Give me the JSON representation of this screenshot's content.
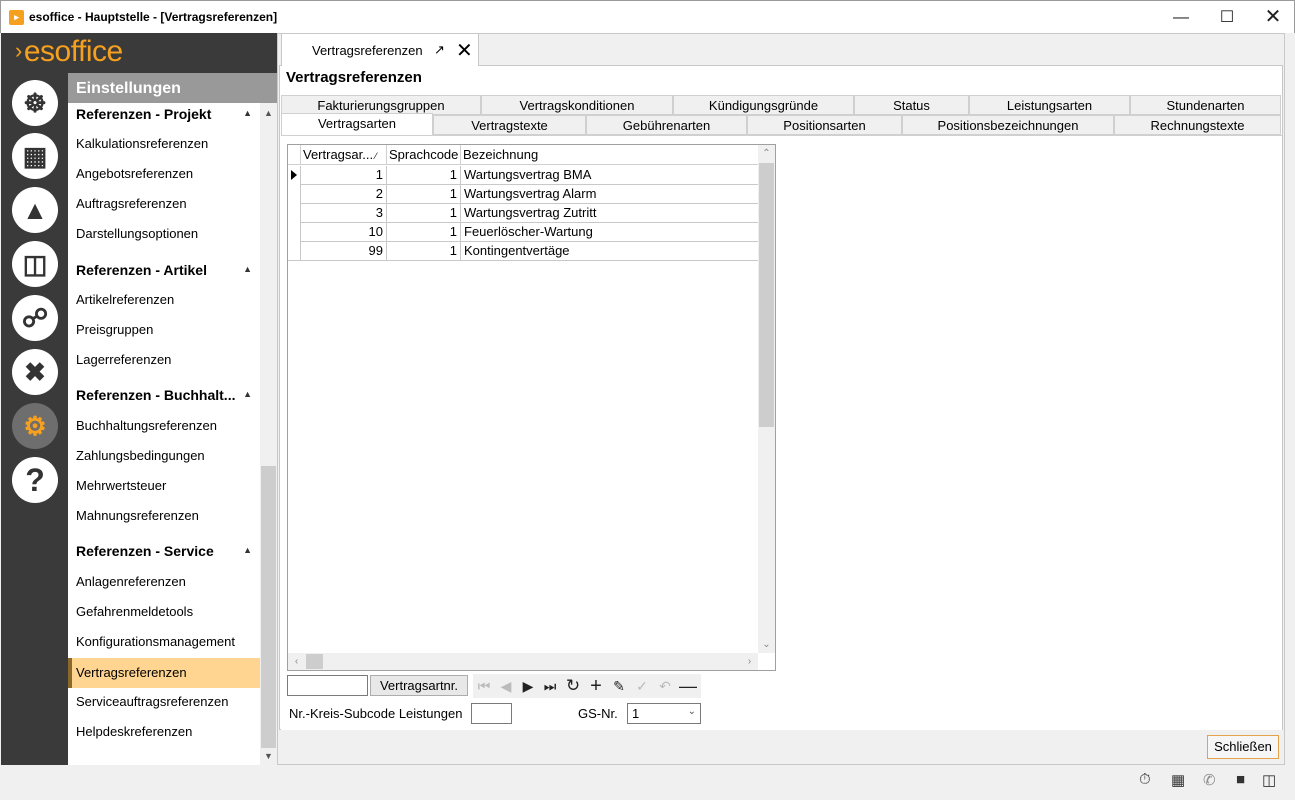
{
  "window": {
    "title": "esoffice - Hauptstelle - [Vertragsreferenzen]",
    "app_icon": "esoffice-app-icon"
  },
  "logo": "esoffice",
  "sidebar_icons": [
    "helm-icon",
    "calculator-icon",
    "siren-icon",
    "money-icon",
    "headset-icon",
    "tools-icon",
    "gears-icon",
    "help-icon"
  ],
  "nav": {
    "header": "Einstellungen",
    "sections": [
      {
        "title": "Referenzen - Projekt",
        "items": [
          "Kalkulationsreferenzen",
          "Angebotsreferenzen",
          "Auftragsreferenzen",
          "Darstellungsoptionen"
        ]
      },
      {
        "title": "Referenzen - Artikel",
        "items": [
          "Artikelreferenzen",
          "Preisgruppen",
          "Lagerreferenzen"
        ]
      },
      {
        "title": "Referenzen - Buchhalt...",
        "items": [
          "Buchhaltungsreferenzen",
          "Zahlungsbedingungen",
          "Mehrwertsteuer",
          "Mahnungsreferenzen"
        ]
      },
      {
        "title": "Referenzen - Service",
        "items": [
          "Anlagenreferenzen",
          "Gefahrenmeldetools",
          "Konfigurationsmanagement",
          "Vertragsreferenzen",
          "Serviceauftragsreferenzen",
          "Helpdeskreferenzen"
        ]
      }
    ],
    "selected": "Vertragsreferenzen"
  },
  "doc_tab": {
    "label": "Vertragsreferenzen"
  },
  "page_title": "Vertragsreferenzen",
  "tabs_row1": [
    "Fakturierungsgruppen",
    "Vertragskonditionen",
    "Kündigungsgründe",
    "Status",
    "Leistungsarten",
    "Stundenarten"
  ],
  "tabs_row2": [
    "Vertragsarten",
    "Vertragstexte",
    "Gebührenarten",
    "Positionsarten",
    "Positionsbezeichnungen",
    "Rechnungstexte"
  ],
  "active_tab": "Vertragsarten",
  "grid": {
    "columns": [
      "Vertragsar...",
      "Sprachcode",
      "Bezeichnung"
    ],
    "sort_indicator": "⁄",
    "rows": [
      [
        "1",
        "1",
        "Wartungsvertrag BMA"
      ],
      [
        "2",
        "1",
        "Wartungsvertrag Alarm"
      ],
      [
        "3",
        "1",
        "Wartungsvertrag Zutritt"
      ],
      [
        "10",
        "1",
        "Feuerlöscher-Wartung"
      ],
      [
        "99",
        "1",
        "Kontingentvertäge"
      ]
    ]
  },
  "search": {
    "value": "",
    "field_button": "Vertragsartnr."
  },
  "navigator": [
    "first",
    "prev",
    "next",
    "last",
    "refresh",
    "add",
    "edit",
    "save",
    "undo",
    "delete"
  ],
  "form": {
    "subcode_label": "Nr.-Kreis-Subcode Leistungen",
    "subcode_value": "",
    "gs_label": "GS-Nr.",
    "gs_value": "1"
  },
  "close_button": "Schließen"
}
